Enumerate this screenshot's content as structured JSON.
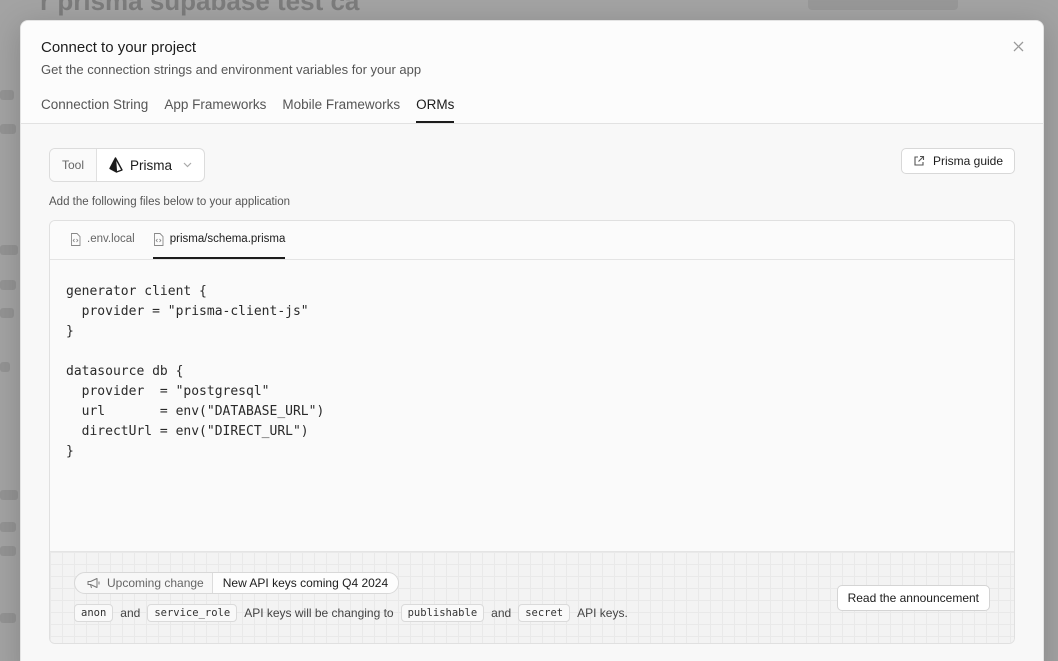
{
  "modal": {
    "title": "Connect to your project",
    "subtitle": "Get the connection strings and environment variables for your app"
  },
  "tabs": [
    {
      "label": "Connection String",
      "active": false
    },
    {
      "label": "App Frameworks",
      "active": false
    },
    {
      "label": "Mobile Frameworks",
      "active": false
    },
    {
      "label": "ORMs",
      "active": true
    }
  ],
  "tool": {
    "label": "Tool",
    "value": "Prisma",
    "guide_label": "Prisma guide"
  },
  "instructions": "Add the following files below to your application",
  "files": [
    {
      "name": ".env.local",
      "active": false
    },
    {
      "name": "prisma/schema.prisma",
      "active": true
    }
  ],
  "code": "generator client {\n  provider = \"prisma-client-js\"\n}\n\ndatasource db {\n  provider  = \"postgresql\"\n  url       = env(\"DATABASE_URL\")\n  directUrl = env(\"DIRECT_URL\")\n}",
  "notice": {
    "badge_left": "Upcoming change",
    "badge_right": "New API keys coming Q4 2024",
    "chip_anon": "anon",
    "text_and_1": "and",
    "chip_service_role": "service_role",
    "text_changing": "API keys will be changing to",
    "chip_publishable": "publishable",
    "text_and_2": "and",
    "chip_secret": "secret",
    "text_end": "API keys.",
    "button_label": "Read the announcement"
  },
  "background": {
    "title_fragment": "r prisma supabase test ca"
  },
  "colors": {
    "accent": "#1c1c1c",
    "overlay": "#a3a3a3"
  }
}
